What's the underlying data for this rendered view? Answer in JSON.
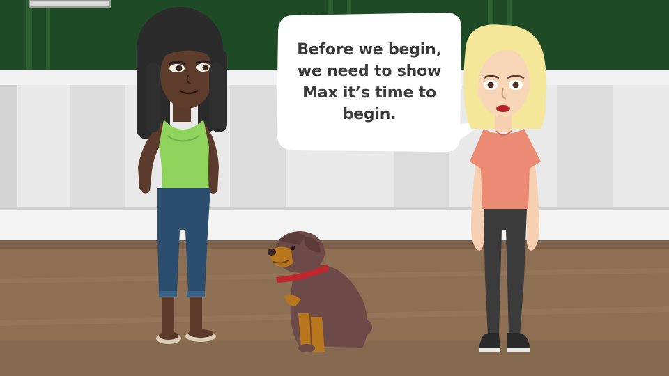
{
  "speech_bubble": {
    "lines": [
      "Before we begin,",
      "we need to show",
      "Max it’s time to",
      "begin."
    ]
  },
  "colors": {
    "hedge": "#1f4a26",
    "wall": "#e9e9e9",
    "floor": "#8d6f54",
    "bubble": "#ffffff",
    "collar": "#c0272d",
    "dog_body": "#6b4a48",
    "dog_tan": "#b8761d"
  }
}
